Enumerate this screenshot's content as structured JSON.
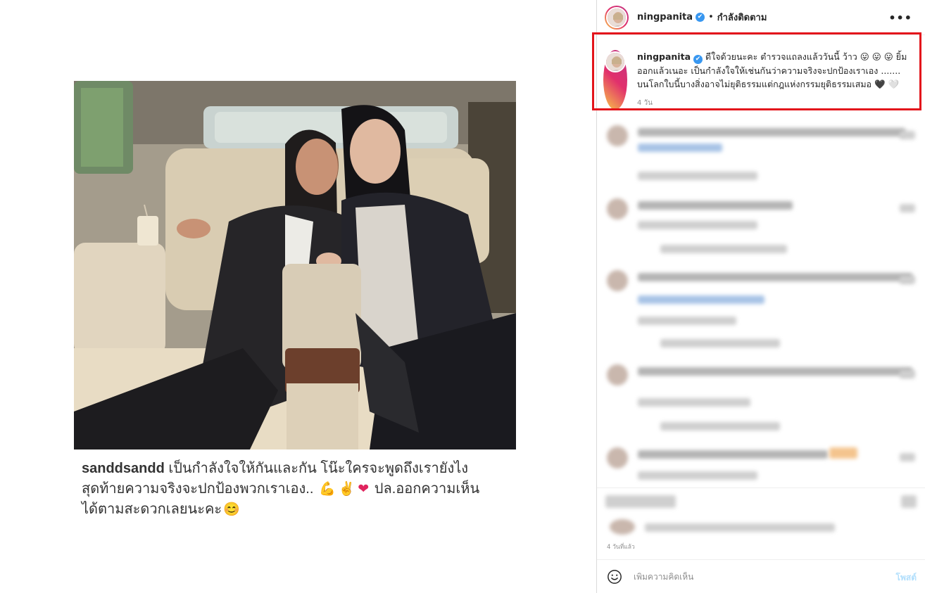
{
  "header": {
    "username": "ningpanita",
    "verified_mark": "✔",
    "separator": "•",
    "follow_status": "กำลังติดตาม",
    "more_label": "•••"
  },
  "caption": {
    "username": "ningpanita",
    "text": " ดีใจด้วยนะคะ ตำรวจแถลงแล้ววันนี้ ว้าว 😛 😛 😛 ยิ้มออกแล้วเนอะ เป็นกำลังใจให้เช่นกันว่าความจริงจะปกป้องเราเอง ....... บนโลกใบนี้บางสิ่งอาจไม่ยุติธรรมแต่กฎแห่งกรรมยุติธรรมเสมอ 🖤 🤍",
    "time": "4 วัน"
  },
  "photo": {
    "quoted_username": "sanddsandd",
    "quoted_text_1": " เป็นกำลังใจให้กันและกัน โน๊ะใครจะพูดถึงเรายังไง",
    "quoted_text_2": "สุดท้ายความจริงจะปกป้องพวกเราเอง..",
    "emoji_1": "💪",
    "emoji_2": "✌",
    "emoji_3": "❤",
    "quoted_text_3": " ปล.ออกความเห็น",
    "quoted_text_4": "ได้ตามสะดวกเลยนะคะ",
    "emoji_4": "😊"
  },
  "footer": {
    "post_time": "4 วันที่แล้ว",
    "comment_placeholder": "เพิ่มความคิดเห็น",
    "post_button": "โพสต์"
  },
  "colors": {
    "highlight": "#e3141b",
    "verified": "#3897f0",
    "post_button_disabled": "#b2dffc"
  },
  "icons": {
    "more": "more-horizontal-icon",
    "emoji": "emoji-smiley-icon",
    "verified": "verified-badge-icon"
  }
}
